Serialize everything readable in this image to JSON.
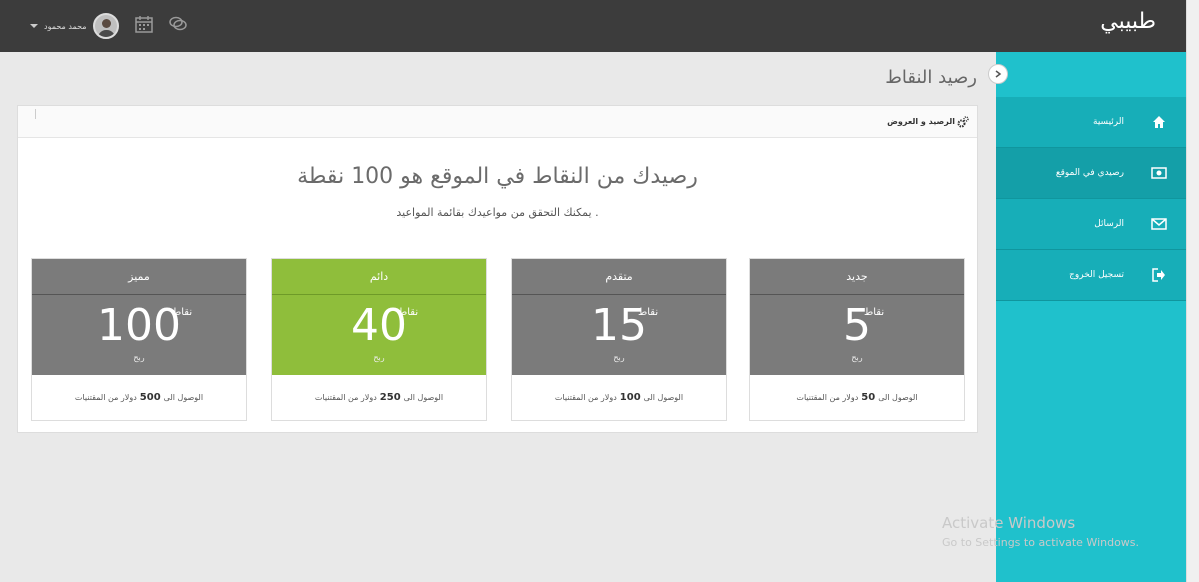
{
  "app": {
    "brand": "طبيبي"
  },
  "header": {
    "user_name": "محمد محمود"
  },
  "sidebar": {
    "items": [
      {
        "label": "الرئيسية",
        "icon": "home-icon"
      },
      {
        "label": "رصيدي في الموقع",
        "icon": "money-icon"
      },
      {
        "label": "الرسائل",
        "icon": "envelope-icon"
      },
      {
        "label": "تسجيل الخروج",
        "icon": "sign-out-icon"
      }
    ]
  },
  "page": {
    "title": "رصيد النقاط"
  },
  "panel": {
    "title": "الرصيد و العروض",
    "headline": "رصيدك من النقاط في الموقع هو 100 نقطة",
    "subline": "يمكنك التحقق من مواعيدك بقائمة المواعيد ."
  },
  "plans": [
    {
      "name": "مميز",
      "points": "100",
      "unit": "نقاط",
      "period": "ربح",
      "foot_pre": "الوصول الى",
      "foot_amount": "500",
      "foot_post": "دولار من المقتنيات"
    },
    {
      "name": "دائم",
      "points": "40",
      "unit": "نقاط",
      "period": "ربح",
      "foot_pre": "الوصول الى",
      "foot_amount": "250",
      "foot_post": "دولار من المقتنيات"
    },
    {
      "name": "متقدم",
      "points": "15",
      "unit": "نقاط",
      "period": "ربح",
      "foot_pre": "الوصول الى",
      "foot_amount": "100",
      "foot_post": "دولار من المقتنيات"
    },
    {
      "name": "جديد",
      "points": "5",
      "unit": "نقاط",
      "period": "ربح",
      "foot_pre": "الوصول الى",
      "foot_amount": "50",
      "foot_post": "دولار من المقتنيات"
    }
  ],
  "colors": {
    "sidebar": "#1fc1cc",
    "header": "#3c3c3c",
    "featured_plan": "#8fbe3b",
    "plan": "#7b7b7b"
  },
  "watermark": {
    "line1": "Activate Windows",
    "line2": "Go to Settings to activate Windows."
  }
}
